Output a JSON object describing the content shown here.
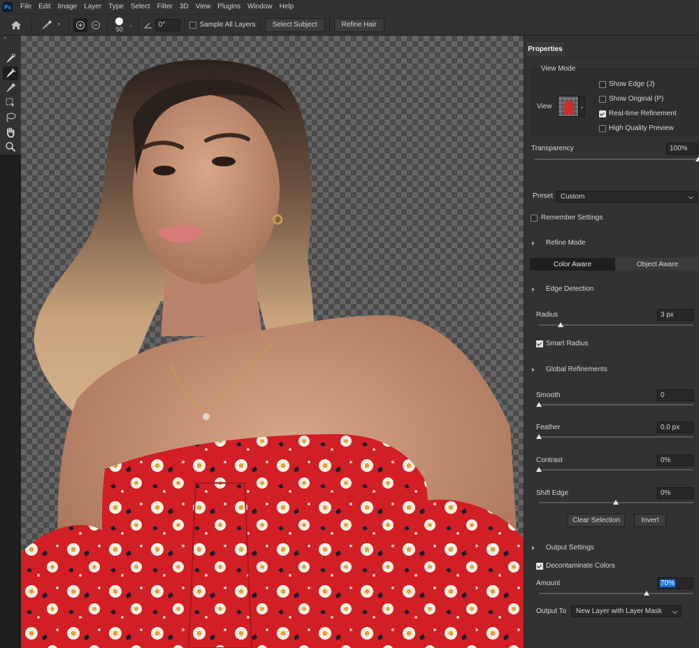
{
  "app": {
    "logo": "Ps"
  },
  "menu": [
    "File",
    "Edit",
    "Image",
    "Layer",
    "Type",
    "Select",
    "Filter",
    "3D",
    "View",
    "Plugins",
    "Window",
    "Help"
  ],
  "options": {
    "brush_size": "50",
    "angle": "0°",
    "sample_all_layers": "Sample All Layers",
    "select_subject": "Select Subject",
    "refine_hair": "Refine Hair"
  },
  "tools": [
    "quick-selection-icon",
    "refine-edge-brush-icon",
    "brush-icon",
    "object-selection-icon",
    "lasso-icon",
    "hand-icon",
    "zoom-icon"
  ],
  "panel": {
    "title": "Properties",
    "view_mode": {
      "heading": "View Mode",
      "view_label": "View",
      "show_edge": "Show Edge (J)",
      "show_original": "Show Original (P)",
      "realtime": "Real-time Refinement",
      "hq_preview": "High Quality Preview"
    },
    "transparency": {
      "label": "Transparency",
      "value": "100%"
    },
    "preset": {
      "label": "Preset",
      "value": "Custom"
    },
    "remember": "Remember Settings",
    "refine_mode": {
      "heading": "Refine Mode",
      "color_aware": "Color Aware",
      "object_aware": "Object Aware"
    },
    "edge_detection": {
      "heading": "Edge Detection",
      "radius_label": "Radius",
      "radius_value": "3 px",
      "smart_radius": "Smart Radius"
    },
    "global": {
      "heading": "Global Refinements",
      "smooth_label": "Smooth",
      "smooth_value": "0",
      "feather_label": "Feather",
      "feather_value": "0.0 px",
      "contrast_label": "Contrast",
      "contrast_value": "0%",
      "shift_label": "Shift Edge",
      "shift_value": "0%"
    },
    "clear_selection": "Clear Selection",
    "invert": "Invert",
    "output": {
      "heading": "Output Settings",
      "decontaminate": "Decontaminate Colors",
      "amount_label": "Amount",
      "amount_value": "70%",
      "output_to_label": "Output To",
      "output_to_value": "New Layer with Layer Mask"
    }
  }
}
